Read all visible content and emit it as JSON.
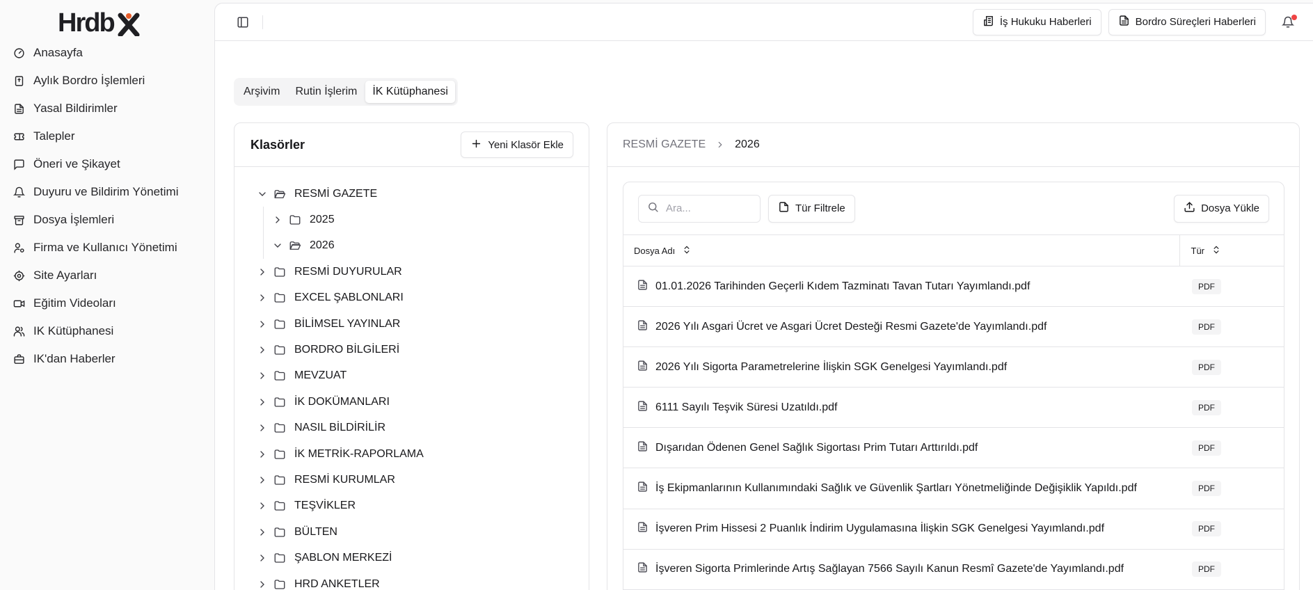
{
  "brand": {
    "logo_text": "Hrdbx",
    "accent": "#e85d2a"
  },
  "sidebar": {
    "items": [
      {
        "label": "Anasayfa",
        "icon": "gauge-icon"
      },
      {
        "label": "Aylık Bordro İşlemleri",
        "icon": "receipt-icon"
      },
      {
        "label": "Yasal Bildirimler",
        "icon": "file-text-icon"
      },
      {
        "label": "Talepler",
        "icon": "ticket-icon"
      },
      {
        "label": "Öneri ve Şikayet",
        "icon": "message-square-icon"
      },
      {
        "label": "Duyuru ve Bildirim Yönetimi",
        "icon": "bell-icon"
      },
      {
        "label": "Dosya İşlemleri",
        "icon": "archive-icon"
      },
      {
        "label": "Firma ve Kullanıcı Yönetimi",
        "icon": "user-cog-icon"
      },
      {
        "label": "Site Ayarları",
        "icon": "settings-icon"
      },
      {
        "label": "Eğitim Videoları",
        "icon": "video-icon"
      },
      {
        "label": "IK Kütüphanesi",
        "icon": "users-icon"
      },
      {
        "label": "IK'dan Haberler",
        "icon": "briefcase-icon"
      }
    ]
  },
  "topbar": {
    "news_labor_law": "İş Hukuku Haberleri",
    "news_payroll": "Bordro Süreçleri Haberleri",
    "notification_dot_color": "#ef4444"
  },
  "tabs": [
    {
      "label": "Arşivim",
      "active": false
    },
    {
      "label": "Rutin İşlerim",
      "active": false
    },
    {
      "label": "İK Kütüphanesi",
      "active": true
    }
  ],
  "folders": {
    "title": "Klasörler",
    "add_button": "Yeni Klasör Ekle",
    "tree": [
      {
        "label": "RESMİ GAZETE",
        "expanded": true,
        "children": [
          {
            "label": "2025",
            "expanded": false
          },
          {
            "label": "2026",
            "expanded": true
          }
        ]
      },
      {
        "label": "RESMİ DUYURULAR"
      },
      {
        "label": "EXCEL ŞABLONLARI"
      },
      {
        "label": "BİLİMSEL YAYINLAR"
      },
      {
        "label": "BORDRO BİLGİLERİ"
      },
      {
        "label": "MEVZUAT"
      },
      {
        "label": "İK DOKÜMANLARI"
      },
      {
        "label": "NASIL BİLDİRİLİR"
      },
      {
        "label": "İK METRİK-RAPORLAMA"
      },
      {
        "label": "RESMİ KURUMLAR"
      },
      {
        "label": "TEŞVİKLER"
      },
      {
        "label": "BÜLTEN"
      },
      {
        "label": "ŞABLON MERKEZİ"
      },
      {
        "label": "HRD ANKETLER"
      }
    ]
  },
  "files": {
    "breadcrumb": {
      "root": "RESMİ GAZETE",
      "current": "2026"
    },
    "search": {
      "placeholder": "Ara...",
      "value": ""
    },
    "filter_button": "Tür Filtrele",
    "upload_button": "Dosya Yükle",
    "columns": {
      "name": "Dosya Adı",
      "type": "Tür"
    },
    "rows": [
      {
        "name": "01.01.2026 Tarihinden Geçerli Kıdem Tazminatı Tavan Tutarı Yayımlandı.pdf",
        "type": "PDF"
      },
      {
        "name": "2026 Yılı Asgari Ücret ve Asgari Ücret Desteği Resmi Gazete'de Yayımlandı.pdf",
        "type": "PDF"
      },
      {
        "name": "2026 Yılı Sigorta Parametrelerine İlişkin SGK Genelgesi Yayımlandı.pdf",
        "type": "PDF"
      },
      {
        "name": "6111 Sayılı Teşvik Süresi Uzatıldı.pdf",
        "type": "PDF"
      },
      {
        "name": "Dışarıdan Ödenen Genel Sağlık Sigortası Prim Tutarı Arttırıldı.pdf",
        "type": "PDF"
      },
      {
        "name": "İş Ekipmanlarının Kullanımındaki Sağlık ve Güvenlik Şartları Yönetmeliğinde Değişiklik Yapıldı.pdf",
        "type": "PDF"
      },
      {
        "name": "İşveren Prim Hissesi 2 Puanlık İndirim Uygulamasına İlişkin SGK Genelgesi Yayımlandı.pdf",
        "type": "PDF"
      },
      {
        "name": "İşveren Sigorta Primlerinde Artış Sağlayan 7566 Sayılı Kanun Resmî Gazete'de Yayımlandı.pdf",
        "type": "PDF"
      }
    ]
  }
}
